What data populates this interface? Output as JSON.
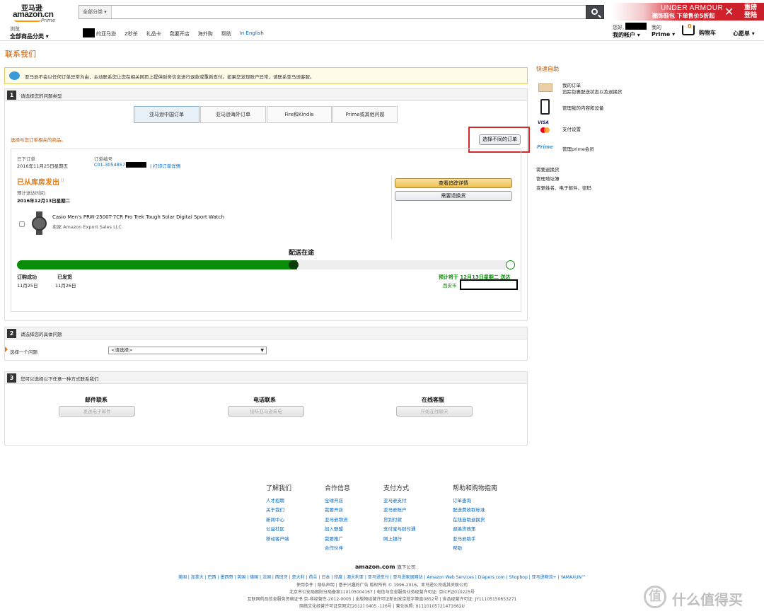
{
  "header": {
    "logo_cn": "亚马逊",
    "logo_en": "amazon.cn",
    "logo_prime": "Prime",
    "search_category": "全部分类",
    "banner_brand": "UNDER ARMOUR",
    "banner_promo": "圈饰鞋包 下单售价5折起",
    "banner_right": "重磅登陆",
    "browse_small": "浏览",
    "browse_big": "全部商品分类",
    "nav_links": [
      "的亚马逊",
      "Z秒杀",
      "礼品卡",
      "我要开店",
      "海外购",
      "帮助",
      "In English"
    ],
    "greeting": "您好,",
    "my_account": "我的帐户",
    "prime_small": "我的",
    "prime": "Prime",
    "cart_count": "0",
    "cart": "购物车",
    "wishlist": "心愿单"
  },
  "page": {
    "title": "联系我们",
    "alert": "亚马逊不会以任何订单异常为由，主动联系您让您在相关网页上提供财务信息进行退款或重新支付。如果您发现账户异常，请联系亚马逊客服。"
  },
  "step1": {
    "num": "1",
    "title": "请选择您的问题类型",
    "tabs": [
      "亚马逊中国订单",
      "亚马逊海外订单",
      "Fire和Kindle",
      "Prime或其他问题"
    ],
    "select_hint": "选择与您订单相关的商品。",
    "change_order": "选择不同的订单",
    "order_date_label": "已下订单",
    "order_date": "2016年11月25日星期五",
    "order_no_label": "订单编号",
    "order_no": "C01-3054857-",
    "print_detail": "打印订单详情",
    "status": "已从库房发出",
    "eta_label": "预计送达时间:",
    "eta": "2016年12月13日星期二",
    "track_btn": "查看追踪详情",
    "return_btn": "需要退换货",
    "product": "Casio Men's PRW-2500T-7CR Pro Trek Tough Solar Digital Sport Watch",
    "seller": "卖家 Amazon Export Sales LLC",
    "delivery_title": "配送在途",
    "progress_pct": 57,
    "m1_label": "订购成功",
    "m1_date": "11月25日",
    "m2_label": "已发货",
    "m2_date": "11月26日",
    "expected": "预计将于 12月13日星期二 送达",
    "city": "西安市"
  },
  "step2": {
    "num": "2",
    "title": "请选择您的具体问题",
    "label": "选择一个问题",
    "select_value": "<请选择>"
  },
  "step3": {
    "num": "3",
    "title": "您可以选择以下任意一种方式联系我们",
    "cols": [
      {
        "h": "邮件联系",
        "btn": "发送电子邮件"
      },
      {
        "h": "电话联系",
        "btn": "接听亚马逊来电"
      },
      {
        "h": "在线客服",
        "btn": "开始在线聊天"
      }
    ]
  },
  "sidebar": {
    "title": "快速自助",
    "items": [
      {
        "icon": "box-icon",
        "line1": "我的订单",
        "line2": "追踪包裹配送状态以及退换货"
      },
      {
        "icon": "device-icon",
        "line1": "管理我的内容和设备",
        "line2": ""
      },
      {
        "icon": "card-icon",
        "line1": "支付设置",
        "line2": ""
      },
      {
        "icon": "prime-icon",
        "line1": "管理prime会员",
        "line2": ""
      }
    ],
    "links": [
      "需要退换货",
      "管理地址簿",
      "变更姓名、电子邮件、密码"
    ],
    "visa": "VISA",
    "prime_logo": "Prime"
  },
  "footer": {
    "cols": [
      {
        "h": "了解我们",
        "items": [
          "人才招聘",
          "关于我们",
          "新闻中心",
          "公益社区",
          "移动客户端"
        ]
      },
      {
        "h": "合作信息",
        "items": [
          "全球开店",
          "我要开店",
          "亚马逊物流",
          "加入联盟",
          "我要推广",
          "合作伙伴"
        ]
      },
      {
        "h": "支付方式",
        "items": [
          "亚马逊支付",
          "亚马逊账户",
          "货到付款",
          "支付宝与财付通",
          "网上银行"
        ]
      },
      {
        "h": "帮助和购物指南",
        "items": [
          "订单查询",
          "配送费收取标准",
          "在线自助退换货",
          "退换货政策",
          "亚马逊助手",
          "帮助"
        ]
      }
    ],
    "logo": "amazon.com",
    "logo_sub": "旗下公司",
    "countries": "美国 | 加拿大 | 巴西 | 墨西哥 | 英国 | 德国 | 法国 | 西班牙 | 意大利 | 荷兰 | 日本 | 印度 | 澳大利亚 | 亚马逊支付 | 亚马逊家居网站 | Amazon Web Services | Diapers.com | Shopbop | 亚马逊物流+ | YAMAXUN™",
    "line2": "使用条件 | 隐私声明 | 基于兴趣的广告  版权所有 © 1996-2016，亚马逊公司或其关联公司",
    "line3": "北京市公安局朝阳分局备案110105004167 | 电信与信息服务业务经营许可证: 京ICP证010225号",
    "line4": "互联网药品信息服务资格证书 京-非经营性-2012-0005 | 出版物经营许可证新出发京批字第直0852号 | 食品经营许可证: JY11105150653271",
    "line5": "网络文化经营许可证京网文[2012] 0405 -126号 | 营业执照: 911101057214716​62U",
    "watermark": "什么值得买",
    "watermark_icon": "值"
  }
}
